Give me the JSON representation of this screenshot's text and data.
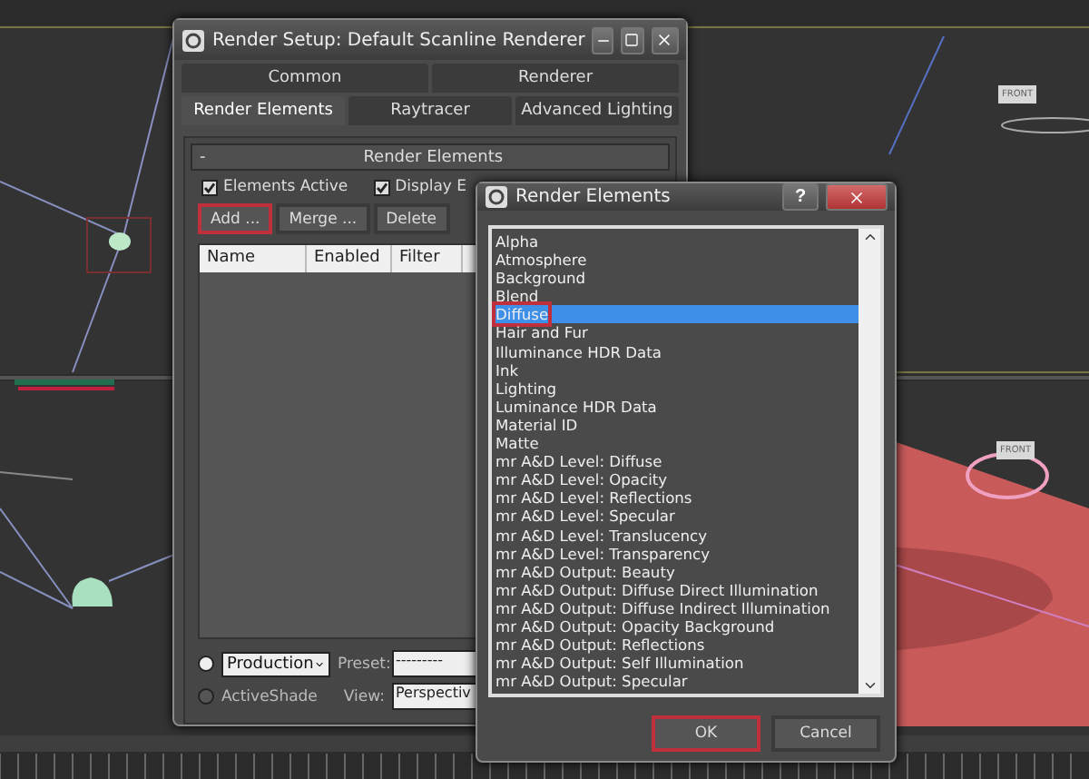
{
  "viewports": {
    "viewcubes": [
      {
        "label": "FRONT"
      },
      {
        "label": "FRONT"
      }
    ]
  },
  "render_setup": {
    "title": "Render Setup: Default Scanline Renderer",
    "tab_rows": [
      [
        {
          "label": "Common",
          "selected": false
        },
        {
          "label": "Renderer",
          "selected": false
        }
      ],
      [
        {
          "label": "Render Elements",
          "selected": true
        },
        {
          "label": "Raytracer",
          "selected": false
        },
        {
          "label": "Advanced Lighting",
          "selected": false
        }
      ]
    ],
    "rollout": {
      "symbol": "-",
      "title": "Render Elements"
    },
    "checkboxes": [
      {
        "label": "Elements Active",
        "checked": true
      },
      {
        "label": "Display E",
        "checked": true
      }
    ],
    "buttons": [
      {
        "label": "Add ...",
        "highlighted": true
      },
      {
        "label": "Merge ...",
        "highlighted": false
      },
      {
        "label": "Delete",
        "highlighted": false
      }
    ],
    "columns": [
      "Name",
      "Enabled",
      "Filter"
    ],
    "modes": [
      {
        "label": "Production",
        "kind": "dropdown",
        "selected": true,
        "field_label": "Preset:",
        "field_value": "---------"
      },
      {
        "label": "ActiveShade",
        "kind": "text",
        "selected": false,
        "field_label": "View:",
        "field_value": "Perspectiv"
      }
    ]
  },
  "dialog": {
    "title": "Render Elements",
    "help": "?",
    "items": [
      {
        "label": "Alpha",
        "selected": false,
        "highlighted": false
      },
      {
        "label": "Atmosphere",
        "selected": false,
        "highlighted": false
      },
      {
        "label": "Background",
        "selected": false,
        "highlighted": false
      },
      {
        "label": "Blend",
        "selected": false,
        "highlighted": false
      },
      {
        "label": "Diffuse",
        "selected": true,
        "highlighted": true
      },
      {
        "label": "Hair and Fur",
        "selected": false,
        "highlighted": false
      },
      {
        "label": "Illuminance HDR Data",
        "selected": false,
        "highlighted": false
      },
      {
        "label": "Ink",
        "selected": false,
        "highlighted": false
      },
      {
        "label": "Lighting",
        "selected": false,
        "highlighted": false
      },
      {
        "label": "Luminance HDR Data",
        "selected": false,
        "highlighted": false
      },
      {
        "label": "Material ID",
        "selected": false,
        "highlighted": false
      },
      {
        "label": "Matte",
        "selected": false,
        "highlighted": false
      },
      {
        "label": "mr A&D Level: Diffuse",
        "selected": false,
        "highlighted": false
      },
      {
        "label": "mr A&D Level: Opacity",
        "selected": false,
        "highlighted": false
      },
      {
        "label": "mr A&D Level: Reflections",
        "selected": false,
        "highlighted": false
      },
      {
        "label": "mr A&D Level: Specular",
        "selected": false,
        "highlighted": false
      },
      {
        "label": "mr A&D Level: Translucency",
        "selected": false,
        "highlighted": false
      },
      {
        "label": "mr A&D Level: Transparency",
        "selected": false,
        "highlighted": false
      },
      {
        "label": "mr A&D Output: Beauty",
        "selected": false,
        "highlighted": false
      },
      {
        "label": "mr A&D Output: Diffuse Direct Illumination",
        "selected": false,
        "highlighted": false
      },
      {
        "label": "mr A&D Output: Diffuse Indirect Illumination",
        "selected": false,
        "highlighted": false
      },
      {
        "label": "mr A&D Output: Opacity Background",
        "selected": false,
        "highlighted": false
      },
      {
        "label": "mr A&D Output: Reflections",
        "selected": false,
        "highlighted": false
      },
      {
        "label": "mr A&D Output: Self Illumination",
        "selected": false,
        "highlighted": false
      },
      {
        "label": "mr A&D Output: Specular",
        "selected": false,
        "highlighted": false
      }
    ],
    "buttons": [
      {
        "label": "OK",
        "highlighted": true
      },
      {
        "label": "Cancel",
        "highlighted": false
      }
    ]
  }
}
